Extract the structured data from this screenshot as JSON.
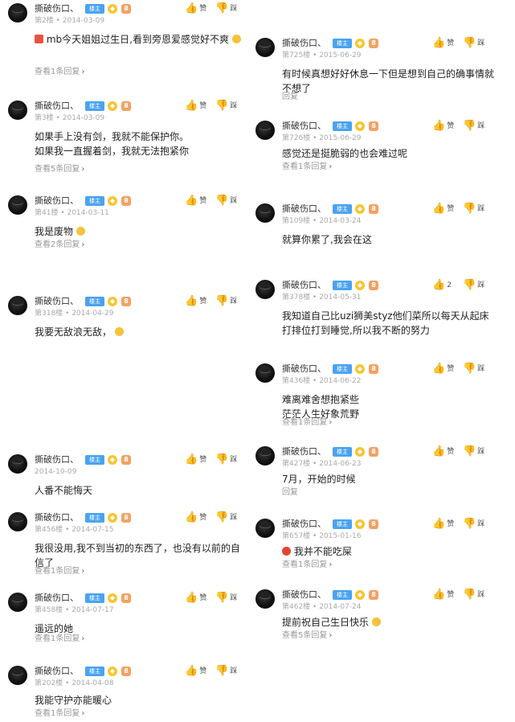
{
  "common": {
    "username": "撕破伤口、",
    "level_badge": "楼主",
    "like_label": "赞",
    "dislike_label": "踩"
  },
  "left_posts": [
    {
      "meta": "第2楼 • 2014-03-09",
      "text": "mb今天姐姐过生日,看到旁恩爱感觉好不爽",
      "reply": "查看1条回复"
    },
    {
      "meta": "第3楼 • 2014-03-09",
      "text": "如果手上没有剑，我就不能保护你。\n如果我一直握着剑，我就无法抱紧你",
      "reply": "查看5条回复"
    },
    {
      "meta": "第41楼 • 2014-03-11",
      "text": "我是废物",
      "reply": "查看2条回复"
    },
    {
      "meta": "第318楼 • 2014-04-29",
      "text": "我要无敌浪无敌，",
      "reply": ""
    },
    {
      "meta": "2014-10-09",
      "text": "人番不能悔天",
      "reply": ""
    },
    {
      "meta": "第456楼 • 2014-07-15",
      "text": "我很没用,我不到当初的东西了，也没有以前的自信了",
      "reply": "查看1条回复"
    },
    {
      "meta": "第458楼 • 2014-07-17",
      "text": "遥远的她",
      "reply": "查看1条回复"
    },
    {
      "meta": "第202楼 • 2014-04-08",
      "text": "我能守护亦能暖心",
      "reply": "查看1条回复"
    }
  ],
  "right_posts": [
    {
      "meta": "第725楼 • 2015-06-29",
      "text": "有时候真想好好休息一下但是想到自己的确事情就不想了",
      "reply": "回复",
      "likes": ""
    },
    {
      "meta": "第726楼 • 2015-06-29",
      "text": "感觉还是挺脆弱的也会难过呢",
      "reply": "查看1条回复",
      "likes": ""
    },
    {
      "meta": "第109楼 • 2014-03-24",
      "text": "就算你累了,我会在这",
      "reply": "",
      "likes": ""
    },
    {
      "meta": "第378楼 • 2014-05-31",
      "text": "我知道自己比uzi狮美styz他们菜所以每天从起床打排位打到睡觉,所以我不断的努力",
      "reply": "",
      "likes": "2"
    },
    {
      "meta": "第436楼 • 2014-06-22",
      "text": "难离难舍想抱紧些\n茫茫人生好象荒野",
      "reply": "查看1条回复",
      "likes": ""
    },
    {
      "meta": "第427楼 • 2014-06-23",
      "text": "7月，开始的时候",
      "reply": "回复",
      "likes": ""
    },
    {
      "meta": "第657楼 • 2015-01-16",
      "text": "我并不能吃屎",
      "reply": "查看1条回复",
      "likes": ""
    },
    {
      "meta": "第462楼 • 2014-07-24",
      "text": "提前祝自己生日快乐",
      "reply": "查看5条回复",
      "likes": ""
    }
  ],
  "colors": {
    "level_badge_bg": "#4aa3f0",
    "gem_badge": "#f7c531",
    "medal_badge": "#f3a262",
    "meta_text": "#aaaaaa",
    "reply_text": "#999999"
  },
  "icons": {
    "like": "thumbs-up-icon",
    "dislike": "thumbs-down-icon",
    "chevron": "chevron-right-icon"
  }
}
